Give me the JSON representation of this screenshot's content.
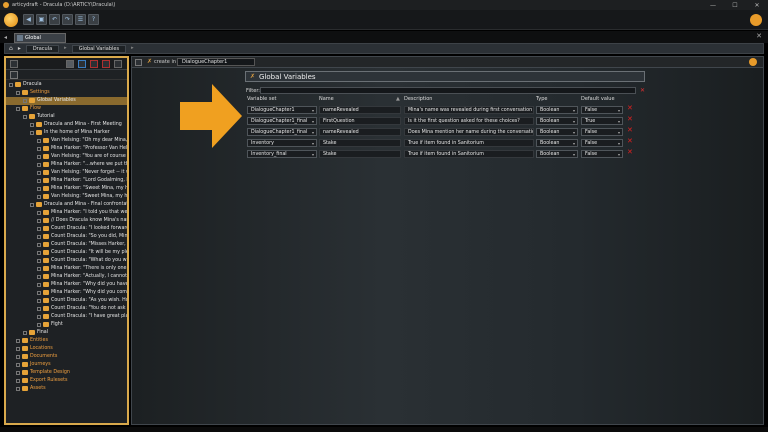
{
  "window": {
    "title": "articydraft - Dracula (D:\\ARTICY\\Dracula\\)",
    "minimize": "—",
    "maximize": "☐",
    "close": "✕"
  },
  "tab": {
    "label": "Global Variables"
  },
  "breadcrumb": [
    "Dracula",
    "Global Variables"
  ],
  "tree": [
    {
      "label": "Dracula",
      "depth": 0,
      "kind": "root"
    },
    {
      "label": "Settings",
      "depth": 1,
      "kind": "orange"
    },
    {
      "label": "Global Variables",
      "depth": 2,
      "kind": "selected"
    },
    {
      "label": "Flow",
      "depth": 1,
      "kind": "orange"
    },
    {
      "label": "Tutorial",
      "depth": 2,
      "kind": "normal"
    },
    {
      "label": "Dracula and Mina - First Meeting",
      "depth": 3,
      "kind": "normal"
    },
    {
      "label": "In the home of Mina Harker",
      "depth": 3,
      "kind": "normal"
    },
    {
      "label": "Van Helsing: \"Oh my dear Mina, I really...",
      "depth": 4,
      "kind": "normal"
    },
    {
      "label": "Mina Harker: \"Professor Van Helsing, W...",
      "depth": 4,
      "kind": "normal"
    },
    {
      "label": "Van Helsing: \"You are of course right. I...",
      "depth": 4,
      "kind": "normal"
    },
    {
      "label": "Mina Harker: \"...where we put the ghou...",
      "depth": 4,
      "kind": "normal"
    },
    {
      "label": "Van Helsing: \"Never forget -- it was not...",
      "depth": 4,
      "kind": "normal"
    },
    {
      "label": "Mina Harker: \"Lord Godalming, Mr. Mo...",
      "depth": 4,
      "kind": "normal"
    },
    {
      "label": "Mina Harker: \"Sweet Mina, my heart ac...",
      "depth": 4,
      "kind": "normal"
    },
    {
      "label": "Van Helsing: \"Sweet Mina, my heart ac...",
      "depth": 4,
      "kind": "normal"
    },
    {
      "label": "Dracula and Mina - Final confrontation",
      "depth": 3,
      "kind": "normal"
    },
    {
      "label": "Mina Harker: \"I told you that we will m...",
      "depth": 4,
      "kind": "normal"
    },
    {
      "label": "// Does Dracula know Mina's name?",
      "depth": 4,
      "kind": "normal"
    },
    {
      "label": "Count Dracula: \"I looked forward to it M...",
      "depth": 4,
      "kind": "normal"
    },
    {
      "label": "Count Dracula: \"So you did, Mina Mina...",
      "depth": 4,
      "kind": "normal"
    },
    {
      "label": "Count Dracula: \"Misses Harker, if you ple...",
      "depth": 4,
      "kind": "normal"
    },
    {
      "label": "Count Dracula: \"It will be my pleasure...",
      "depth": 4,
      "kind": "normal"
    },
    {
      "label": "Count Dracula: \"What do you want to kn...",
      "depth": 4,
      "kind": "normal"
    },
    {
      "label": "Mina Harker: \"There is only one questi...",
      "depth": 4,
      "kind": "normal"
    },
    {
      "label": "Mina Harker: \"Actually, I cannot think o...",
      "depth": 4,
      "kind": "normal"
    },
    {
      "label": "Mina Harker: \"Why did you have to kill...",
      "depth": 4,
      "kind": "normal"
    },
    {
      "label": "Mina Harker: \"Why did you come to Lo...",
      "depth": 4,
      "kind": "normal"
    },
    {
      "label": "Count Dracula: \"As you wish. However,...",
      "depth": 4,
      "kind": "normal"
    },
    {
      "label": "Count Dracula: \"You do not ask the last...",
      "depth": 4,
      "kind": "normal"
    },
    {
      "label": "Count Dracula: \"I have great plans for t...",
      "depth": 4,
      "kind": "normal"
    },
    {
      "label": "Fight",
      "depth": 4,
      "kind": "normal"
    },
    {
      "label": "Final",
      "depth": 2,
      "kind": "normal"
    },
    {
      "label": "Entities",
      "depth": 1,
      "kind": "orange"
    },
    {
      "label": "Locations",
      "depth": 1,
      "kind": "orange"
    },
    {
      "label": "Documents",
      "depth": 1,
      "kind": "orange"
    },
    {
      "label": "Journeys",
      "depth": 1,
      "kind": "orange"
    },
    {
      "label": "Template Design",
      "depth": 1,
      "kind": "orange"
    },
    {
      "label": "Export Rulesets",
      "depth": 1,
      "kind": "orange"
    },
    {
      "label": "Assets",
      "depth": 1,
      "kind": "orange"
    }
  ],
  "editor": {
    "create_in_label": "create in",
    "create_in_value": "DialogueChapter1",
    "panel_title": "Global Variables",
    "filter_label": "Filter:",
    "columns": {
      "set": "Variable set",
      "name": "Name",
      "description": "Description",
      "type": "Type",
      "default": "Default value"
    },
    "rows": [
      {
        "set": "DialogueChapter1",
        "name": "nameRevealed",
        "description": "Mina's name was revealed during first conversation",
        "type": "Boolean",
        "default": "False"
      },
      {
        "set": "DialogueChapter1_final",
        "name": "FirstQuestion",
        "description": "Is it the first question asked for these choices?",
        "type": "Boolean",
        "default": "True"
      },
      {
        "set": "DialogueChapter1_final",
        "name": "nameRevealed",
        "description": "Does Mina mention her name during the conversation?",
        "type": "Boolean",
        "default": "False"
      },
      {
        "set": "Inventory",
        "name": "Stake",
        "description": "True if item found in Sanitorium",
        "type": "Boolean",
        "default": "False"
      },
      {
        "set": "Inventory_final",
        "name": "Stake",
        "description": "True if item found in Sanitorium",
        "type": "Boolean",
        "default": "False"
      }
    ]
  },
  "colors": {
    "accent_orange": "#f0a020",
    "delete_red": "#e02020",
    "selection": "#8a6a2e"
  }
}
